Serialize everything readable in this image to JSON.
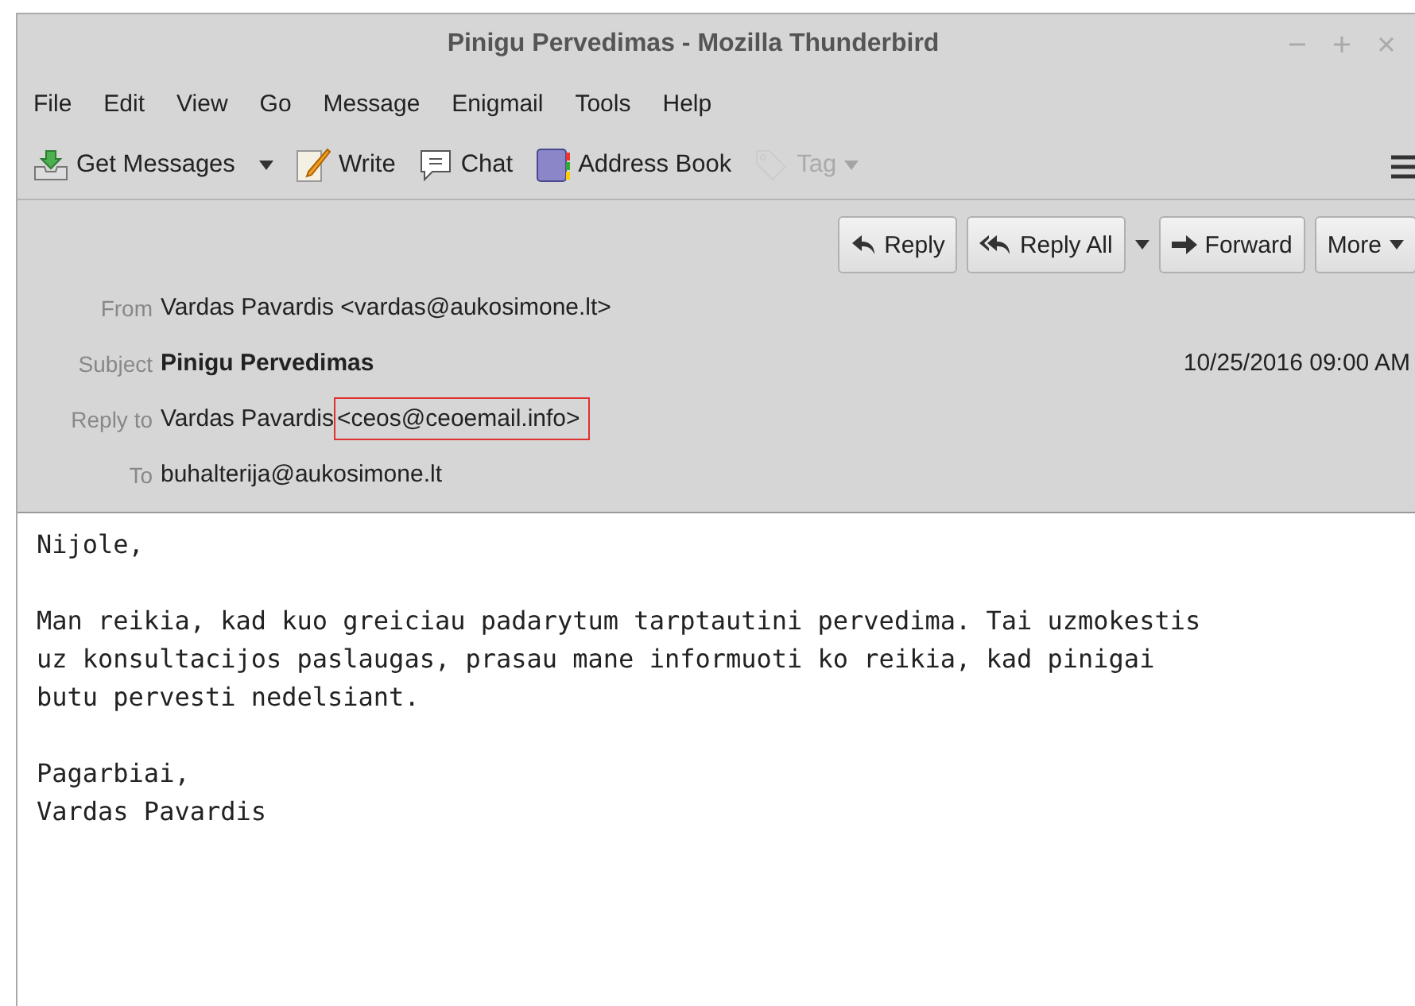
{
  "window": {
    "title": "Pinigu Pervedimas - Mozilla Thunderbird"
  },
  "menu": [
    "File",
    "Edit",
    "View",
    "Go",
    "Message",
    "Enigmail",
    "Tools",
    "Help"
  ],
  "toolbar": [
    {
      "kind": "get",
      "label": "Get Messages",
      "disabled": false,
      "dropdown": true
    },
    {
      "kind": "write",
      "label": "Write",
      "disabled": false,
      "dropdown": false
    },
    {
      "kind": "chat",
      "label": "Chat",
      "disabled": false,
      "dropdown": false
    },
    {
      "kind": "book",
      "label": "Address Book",
      "disabled": false,
      "dropdown": false
    },
    {
      "kind": "tag",
      "label": "Tag",
      "disabled": true,
      "dropdown": true
    }
  ],
  "actions": [
    {
      "kind": "reply",
      "label": "Reply",
      "dropdown": false
    },
    {
      "kind": "replyall",
      "label": "Reply All",
      "dropdown": true
    },
    {
      "kind": "forward",
      "label": "Forward",
      "dropdown": false
    },
    {
      "kind": "more",
      "label": "More",
      "dropdown": true
    }
  ],
  "headers": [
    {
      "label": "From",
      "value": "Vardas Pavardis <vardas@aukosimone.lt>",
      "bold": false
    },
    {
      "label": "Subject",
      "value": "Pinigu Pervedimas",
      "bold": true,
      "date": "10/25/2016 09:00 AM"
    },
    {
      "label": "Reply to",
      "value": "Vardas Pavardis",
      "bold": false,
      "address": "<ceos@ceoemail.info>",
      "highlighted": true
    },
    {
      "label": "To",
      "value": "buhalterija@aukosimone.lt",
      "bold": false
    }
  ],
  "body": [
    [
      "Nijole,"
    ],
    [
      "Man reikia, kad kuo greiciau padarytum tarptautini pervedima. Tai uzmokestis",
      "uz konsultacijos paslaugas, prasau mane informuoti ko reikia, kad pinigai",
      "butu pervesti nedelsiant."
    ],
    [
      "Pagarbiai,",
      "Vardas Pavardis"
    ]
  ]
}
